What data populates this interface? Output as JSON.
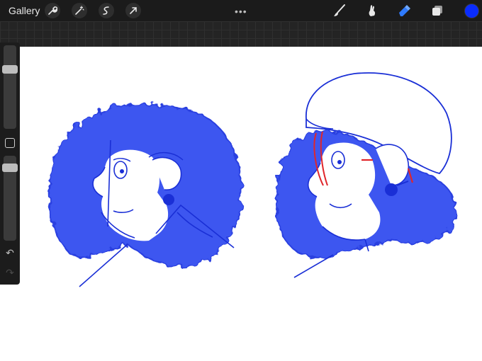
{
  "toolbar": {
    "gallery_label": "Gallery",
    "left_tools": [
      "wrench-icon",
      "magic-wand-icon",
      "selection-icon",
      "transform-arrow-icon"
    ],
    "more_dots": "•••",
    "right_tools": [
      "brush-icon",
      "smudge-icon",
      "eraser-icon",
      "layers-icon"
    ],
    "current_color": "#0a2cff"
  },
  "sidebar": {
    "brush_size_level": 0.74,
    "opacity_level": 0.9,
    "undo_icon": "↶",
    "redo_icon": "↷"
  },
  "colors": {
    "stroke_blue": "#1a2fd6",
    "fill_blue": "#3d57f0",
    "accent_red": "#e0262b"
  }
}
